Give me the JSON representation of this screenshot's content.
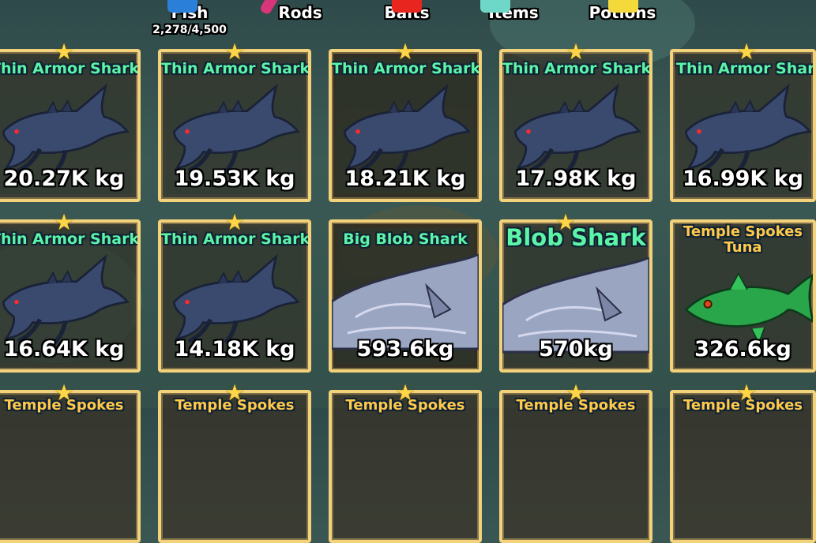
{
  "tabs": [
    {
      "label": "Fish",
      "count": "2,278/4,500",
      "color": "#2a7fd8"
    },
    {
      "label": "Rods",
      "color": "#d9357a"
    },
    {
      "label": "Baits",
      "color": "#e8261f"
    },
    {
      "label": "Items",
      "color": "#6fd7c8"
    },
    {
      "label": "Potions",
      "color": "#f4d93a"
    }
  ],
  "cards": [
    {
      "name": "Thin Armor Shark",
      "weight": "20.27K kg",
      "fish": "armor-shark"
    },
    {
      "name": "Thin Armor Shark",
      "weight": "19.53K kg",
      "fish": "armor-shark"
    },
    {
      "name": "Thin Armor Shark",
      "weight": "18.21K kg",
      "fish": "armor-shark"
    },
    {
      "name": "Thin Armor Shark",
      "weight": "17.98K kg",
      "fish": "armor-shark"
    },
    {
      "name": "Thin Armor Shar",
      "weight": "16.99K kg",
      "fish": "armor-shark"
    },
    {
      "name": "Thin Armor Shark",
      "weight": "16.64K kg",
      "fish": "armor-shark"
    },
    {
      "name": "Thin Armor Shark",
      "weight": "14.18K kg",
      "fish": "armor-shark"
    },
    {
      "name": "Big Blob Shark",
      "weight": "593.6kg",
      "fish": "blob-shark"
    },
    {
      "name": "Blob Shark",
      "weight": "570kg",
      "fish": "blob-shark"
    },
    {
      "name": "Temple Spokes Tuna",
      "weight": "326.6kg",
      "fish": "tuna"
    },
    {
      "name": "Temple Spokes",
      "weight": "",
      "fish": "tuna"
    },
    {
      "name": "Temple Spokes",
      "weight": "",
      "fish": "tuna"
    },
    {
      "name": "Temple Spokes",
      "weight": "",
      "fish": "tuna"
    },
    {
      "name": "Temple Spokes",
      "weight": "",
      "fish": "tuna"
    },
    {
      "name": "Temple Spokes",
      "weight": "",
      "fish": "tuna"
    }
  ]
}
